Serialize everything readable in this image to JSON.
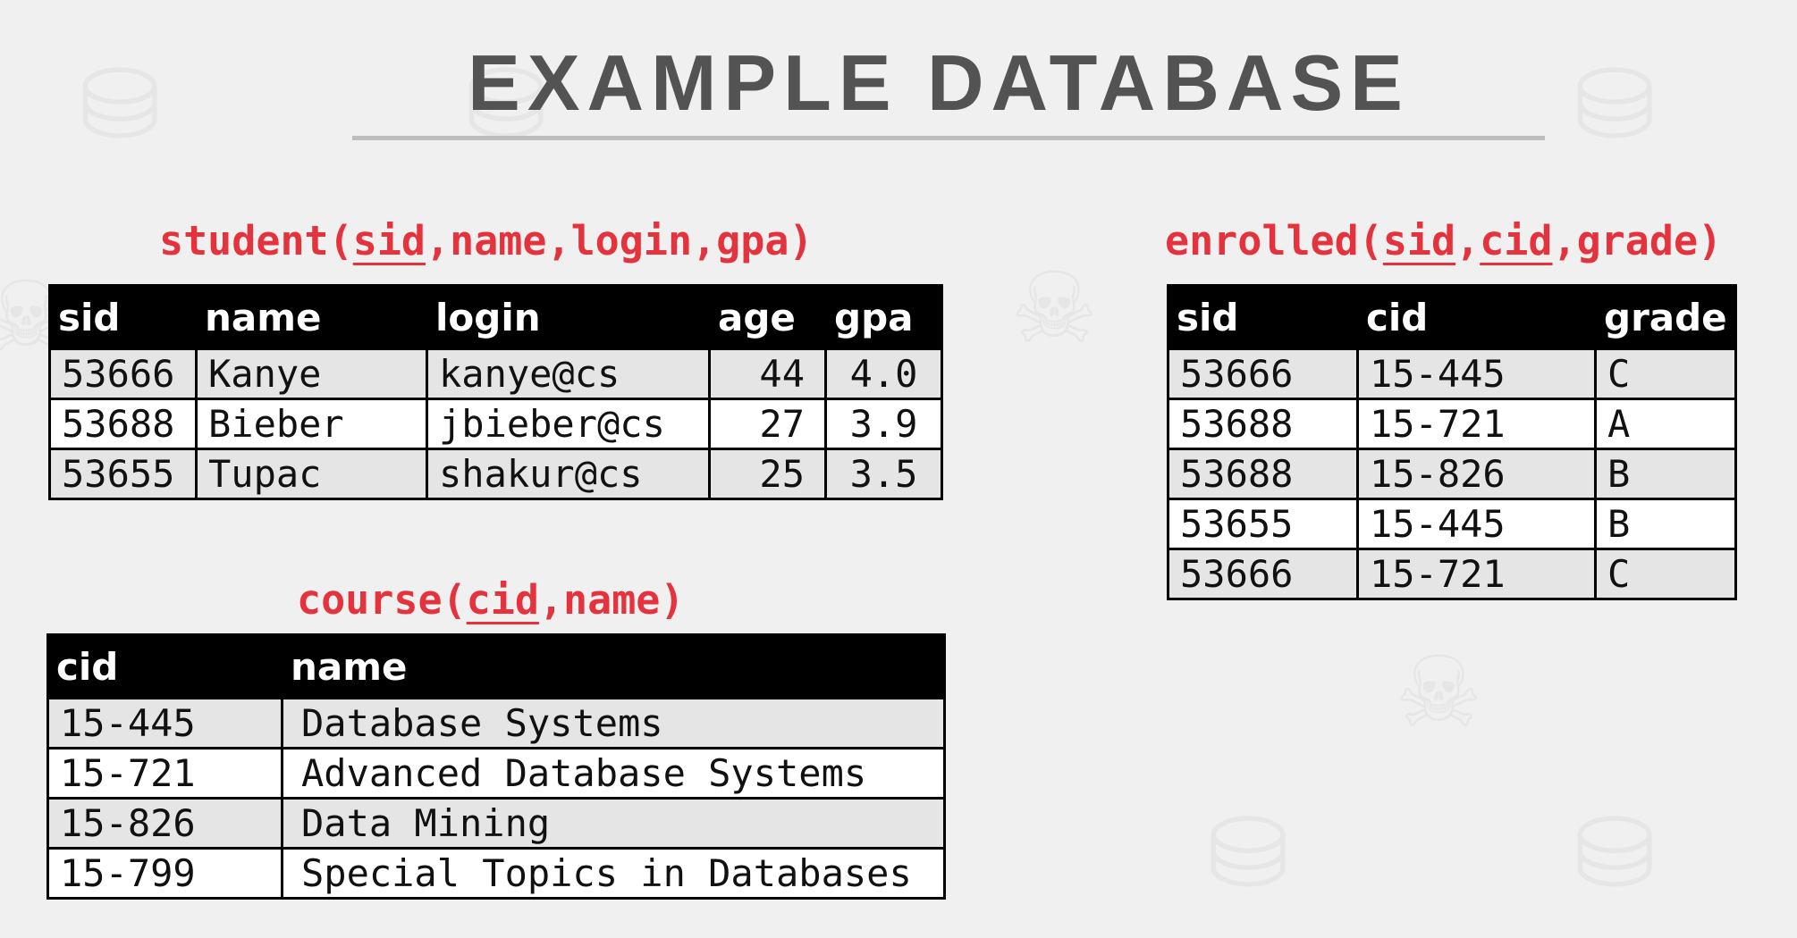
{
  "title": "EXAMPLE DATABASE",
  "colors": {
    "schema_red": "#e5333d",
    "title_gray": "#535353",
    "header_bg": "#000000",
    "row_shaded": "#e5e5e5",
    "row_plain": "#ffffff"
  },
  "student": {
    "schema": {
      "name": "student",
      "open": "(",
      "key": "sid",
      "rest": ",name,login,gpa",
      "close": ")"
    },
    "columns": [
      "sid",
      "name",
      "login",
      "age",
      "gpa"
    ],
    "rows": [
      [
        "53666",
        "Kanye",
        "kanye@cs",
        "44",
        "4.0"
      ],
      [
        "53688",
        "Bieber",
        "jbieber@cs",
        "27",
        "3.9"
      ],
      [
        "53655",
        "Tupac",
        "shakur@cs",
        "25",
        "3.5"
      ]
    ]
  },
  "enrolled": {
    "schema": {
      "name": "enrolled",
      "open": "(",
      "key1": "sid",
      "comma": ",",
      "key2": "cid",
      "rest": ",grade",
      "close": ")"
    },
    "columns": [
      "sid",
      "cid",
      "grade"
    ],
    "rows": [
      [
        "53666",
        "15-445",
        "C"
      ],
      [
        "53688",
        "15-721",
        "A"
      ],
      [
        "53688",
        "15-826",
        "B"
      ],
      [
        "53655",
        "15-445",
        "B"
      ],
      [
        "53666",
        "15-721",
        "C"
      ]
    ]
  },
  "course": {
    "schema": {
      "name": "course",
      "open": "(",
      "key": "cid",
      "rest": ",name",
      "close": ")"
    },
    "columns": [
      "cid",
      "name"
    ],
    "rows": [
      [
        "15-445",
        "Database Systems"
      ],
      [
        "15-721",
        "Advanced Database Systems"
      ],
      [
        "15-826",
        "Data Mining"
      ],
      [
        "15-799",
        "Special Topics in Databases"
      ]
    ]
  }
}
